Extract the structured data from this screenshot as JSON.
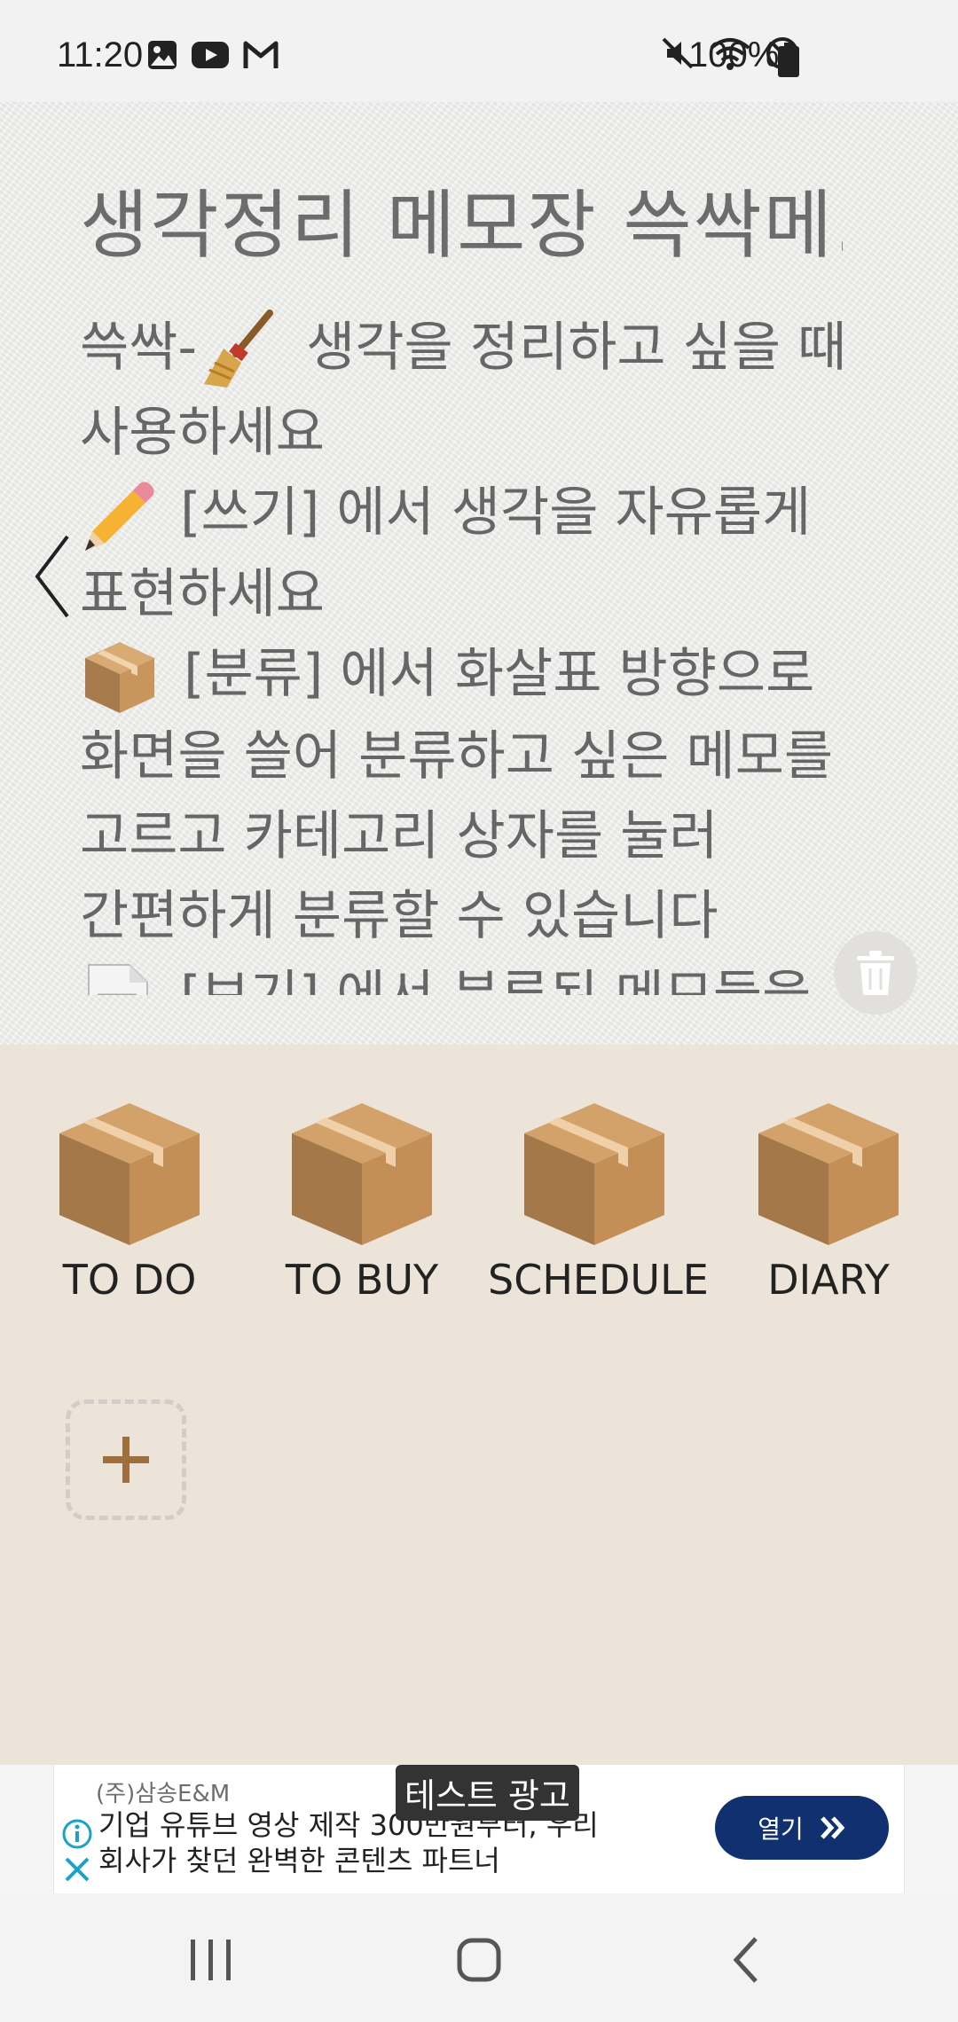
{
  "status_bar": {
    "time": "11:20",
    "battery": "100%",
    "left_icons": [
      "gallery-icon",
      "youtube-icon",
      "gmail-icon"
    ],
    "right_icons": [
      "mute-icon",
      "wifi-icon",
      "do-not-disturb-icon",
      "battery-icon"
    ]
  },
  "memo": {
    "title": "생각정리 메모장 쓱싹메...",
    "lines": [
      {
        "icon": "broom-icon",
        "prefix": "쓱싹-",
        "text": " 생각을 정리하고 싶을 때"
      },
      {
        "icon": "",
        "prefix": "",
        "text": "사용하세요"
      },
      {
        "icon": "pencil-icon",
        "prefix": "",
        "text": " [쓰기] 에서 생각을 자유롭게"
      },
      {
        "icon": "",
        "prefix": "",
        "text": "표현하세요"
      },
      {
        "icon": "package-icon",
        "prefix": "",
        "text": " [분류] 에서 화살표 방향으로"
      },
      {
        "icon": "",
        "prefix": "",
        "text": "화면을 쓸어 분류하고 싶은 메모를"
      },
      {
        "icon": "",
        "prefix": "",
        "text": "고르고 카테고리 상자를 눌러"
      },
      {
        "icon": "",
        "prefix": "",
        "text": "간편하게 분류할 수 있습니다"
      },
      {
        "icon": "document-icon",
        "prefix": "",
        "text": " [보기] 에서 분류된 메모들을"
      }
    ]
  },
  "categories": [
    {
      "label": "TO DO"
    },
    {
      "label": "TO BUY"
    },
    {
      "label": "SCHEDULE"
    },
    {
      "label": "DIARY"
    }
  ],
  "ad": {
    "advertiser": "(주)삼송E&M",
    "test_label": "테스트 광고",
    "line1": "기업 유튜브 영상 제작 300만원부터, 우리",
    "line2": "회사가 찾던 완벽한 콘텐츠 파트너",
    "cta": "열기"
  },
  "colors": {
    "memo_bg": "#ececea",
    "category_bg": "#ece4d8",
    "box_front": "#a77b4b",
    "box_side": "#c8965c",
    "box_top": "#d6a56b",
    "ad_button": "#10306f"
  }
}
